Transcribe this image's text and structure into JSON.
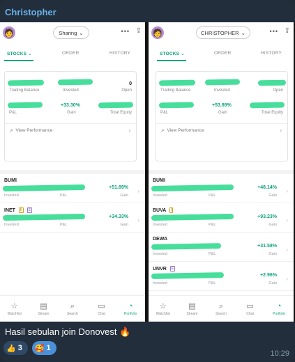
{
  "sender": "Christopher",
  "caption": "Hasil sebulan join Donovest 🔥",
  "time": "10:29",
  "reactions": [
    {
      "emoji": "👍",
      "count": "3"
    },
    {
      "emoji": "🥰",
      "count": "1"
    }
  ],
  "screens": [
    {
      "pill_label": "Sharing",
      "tabs": [
        "STOCKS ⌄",
        "ORDER",
        "HISTORY"
      ],
      "summary": {
        "open_value": "0",
        "labels": [
          "Trading Balance",
          "Invested",
          "Open",
          "P&L",
          "Gain",
          "Total Equity"
        ],
        "gain_value": "+33.30%"
      },
      "view_performance": "View Performance",
      "rows": [
        {
          "ticker": "BUMI",
          "badge": "",
          "pct": "+51.89%"
        },
        {
          "ticker": "INET",
          "badge": "II",
          "pct": "+34.33%"
        }
      ]
    },
    {
      "pill_label": "CHRISTOPHER",
      "tabs": [
        "STOCKS ⌄",
        "ORDER",
        "HISTORY"
      ],
      "summary": {
        "open_value": "",
        "labels": [
          "Trading Balance",
          "Invested",
          "Open",
          "P&L",
          "Gain",
          "Total Equity"
        ],
        "gain_value": "+53.89%"
      },
      "view_performance": "View Performance",
      "rows": [
        {
          "ticker": "BUMI",
          "badge": "",
          "pct": "+48.14%"
        },
        {
          "ticker": "BUVA",
          "badge": "I",
          "pct": "+93.23%"
        },
        {
          "ticker": "DEWA",
          "badge": "",
          "pct": "+31.58%"
        },
        {
          "ticker": "UNVR",
          "badge": "E",
          "pct": "+2.96%"
        }
      ]
    }
  ],
  "row_labels": {
    "invested": "Invested",
    "pl": "P&L",
    "gain": "Gain"
  },
  "nav": [
    "Watchlist",
    "Stream",
    "Search",
    "Chat",
    "Portfolio"
  ],
  "nav_icons": [
    "star-icon",
    "stream-icon",
    "search-icon",
    "chat-icon",
    "portfolio-icon"
  ],
  "accent": "#10a37f",
  "redaction_color": "#3ddc97"
}
